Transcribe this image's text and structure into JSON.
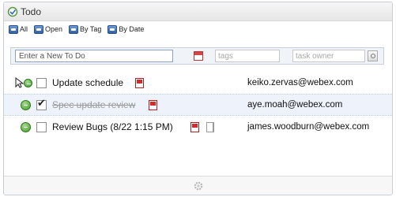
{
  "window": {
    "title": "Todo"
  },
  "toolbar": {
    "buttons": [
      {
        "label": "All",
        "icon": "list-icon"
      },
      {
        "label": "Open",
        "icon": "open-icon"
      },
      {
        "label": "By Tag",
        "icon": "tag-icon"
      },
      {
        "label": "By Date",
        "icon": "calendar-icon"
      }
    ]
  },
  "entry": {
    "new_todo_placeholder": "Enter a New To Do",
    "tags_placeholder": "tags",
    "owner_placeholder": "task owner"
  },
  "tasks": [
    {
      "title": "Update schedule",
      "owner": "keiko.zervas@webex.com",
      "completed": false
    },
    {
      "title": "Spec update review",
      "owner": "aye.moah@webex.com",
      "completed": true
    },
    {
      "title": "Review Bugs  (8/22 1:15 PM)",
      "owner": "james.woodburn@webex.com",
      "completed": false
    }
  ],
  "colors": {
    "accent": "#2f5fa8",
    "bullet": "#3f9a2a",
    "attachment": "#d42a2a"
  }
}
